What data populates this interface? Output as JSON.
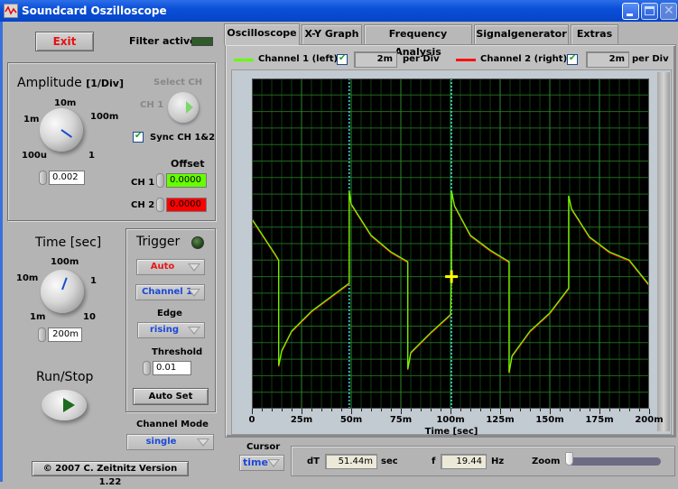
{
  "window": {
    "title": "Soundcard Oszilloscope",
    "buttons": [
      "minimize",
      "maximize",
      "close"
    ]
  },
  "left": {
    "exit_label": "Exit",
    "filter_label": "Filter active",
    "filter_active": false,
    "amplitude": {
      "title": "Amplitude",
      "unit": "[1/Div]",
      "knob_labels": [
        "100u",
        "1m",
        "10m",
        "100m",
        "1"
      ],
      "value": "0.002"
    },
    "select_ch": {
      "label": "Select CH",
      "value": "CH 1"
    },
    "sync_label": "Sync CH 1&2",
    "sync_checked": true,
    "offset": {
      "title": "Offset",
      "ch1_label": "CH 1",
      "ch1_value": "0.0000",
      "ch1_color": "#66ff00",
      "ch2_label": "CH 2",
      "ch2_value": "0.0000",
      "ch2_color": "#ff0000"
    },
    "time": {
      "title": "Time [sec]",
      "knob_labels": [
        "1m",
        "10m",
        "100m",
        "1",
        "10"
      ],
      "value": "200m"
    },
    "trigger": {
      "title": "Trigger",
      "mode": "Auto",
      "source": "Channel 1",
      "edge_label": "Edge",
      "edge": "rising",
      "threshold_label": "Threshold",
      "threshold": "0.01",
      "autoset_label": "Auto Set"
    },
    "run_stop_label": "Run/Stop",
    "channel_mode_label": "Channel Mode",
    "channel_mode": "single",
    "copyright": "© 2007   C. Zeitnitz Version 1.22"
  },
  "tabs": [
    {
      "label": "Oscilloscope",
      "active": true
    },
    {
      "label": "X-Y Graph",
      "active": false
    },
    {
      "label": "Frequency Analysis",
      "active": false
    },
    {
      "label": "Signalgenerator",
      "active": false
    },
    {
      "label": "Extras",
      "active": false
    }
  ],
  "scope": {
    "ch1": {
      "label": "Channel 1 (left)",
      "checked": true,
      "per_div": "2m",
      "color": "#66ff00"
    },
    "ch2": {
      "label": "Channel 2 (right)",
      "checked": true,
      "per_div": "2m",
      "color": "#ff1010"
    },
    "per_div_label": "per Div"
  },
  "cursor": {
    "label": "Cursor",
    "mode": "time",
    "dT_label": "dT",
    "dT_value": "51.44m",
    "dT_unit": "sec",
    "f_label": "f",
    "f_value": "19.44",
    "f_unit": "Hz",
    "zoom_label": "Zoom",
    "zoom_level": 0.0
  },
  "chart_data": {
    "type": "line",
    "title": "",
    "xlabel": "Time [sec]",
    "ylabel": "",
    "xlim": [
      0,
      0.2
    ],
    "ylim": [
      -10,
      10
    ],
    "x_ticks": [
      "0",
      "25m",
      "50m",
      "75m",
      "100m",
      "125m",
      "150m",
      "175m",
      "200m"
    ],
    "grid": true,
    "background": "#000000",
    "grid_color": "#1f6a1f",
    "cursors_x": [
      0.049,
      0.1005
    ],
    "cursor_marker": {
      "x": 0.1005,
      "y": -2.0
    },
    "series": [
      {
        "name": "Channel 1 (left)",
        "color": "#66ff00",
        "description": "sawtooth-like capacitor charge/discharge, period ~51.4 ms",
        "x": [
          0,
          0.012,
          0.0135,
          0.0135,
          0.015,
          0.02,
          0.03,
          0.04,
          0.049,
          0.049,
          0.05,
          0.06,
          0.07,
          0.0785,
          0.0785,
          0.08,
          0.09,
          0.1,
          0.1005,
          0.1005,
          0.102,
          0.11,
          0.12,
          0.1295,
          0.1295,
          0.131,
          0.14,
          0.15,
          0.1595,
          0.1595,
          0.161,
          0.17,
          0.18,
          0.19,
          0.2
        ],
        "y": [
          1.5,
          -0.7,
          -1.0,
          -7.4,
          -6.5,
          -5.3,
          -4.1,
          -3.2,
          -2.4,
          3.2,
          2.4,
          0.5,
          -0.5,
          -1.1,
          -7.6,
          -6.6,
          -5.4,
          -4.3,
          -2.1,
          3.2,
          2.3,
          0.5,
          -0.4,
          -1.1,
          -7.8,
          -6.8,
          -5.3,
          -4.2,
          -2.7,
          2.9,
          2.1,
          0.4,
          -0.5,
          -1.0,
          -2.5
        ]
      },
      {
        "name": "Channel 2 (right)",
        "color": "#ff1010",
        "description": "nearly identical to channel 1 (overlapping)",
        "x": [
          0,
          0.012,
          0.0135,
          0.0135,
          0.015,
          0.02,
          0.03,
          0.04,
          0.049,
          0.049,
          0.05,
          0.06,
          0.07,
          0.0785,
          0.0785,
          0.08,
          0.09,
          0.1,
          0.1005,
          0.1005,
          0.102,
          0.11,
          0.12,
          0.1295,
          0.1295,
          0.131,
          0.14,
          0.15,
          0.1595,
          0.1595,
          0.161,
          0.17,
          0.18,
          0.19,
          0.2
        ],
        "y": [
          1.5,
          -0.7,
          -1.0,
          -7.4,
          -6.5,
          -5.3,
          -4.1,
          -3.2,
          -2.4,
          3.2,
          2.4,
          0.5,
          -0.5,
          -1.1,
          -7.6,
          -6.6,
          -5.4,
          -4.3,
          -2.1,
          3.2,
          2.3,
          0.5,
          -0.4,
          -1.1,
          -7.8,
          -6.8,
          -5.3,
          -4.2,
          -2.7,
          2.9,
          2.1,
          0.4,
          -0.5,
          -1.0,
          -2.5
        ]
      }
    ]
  }
}
